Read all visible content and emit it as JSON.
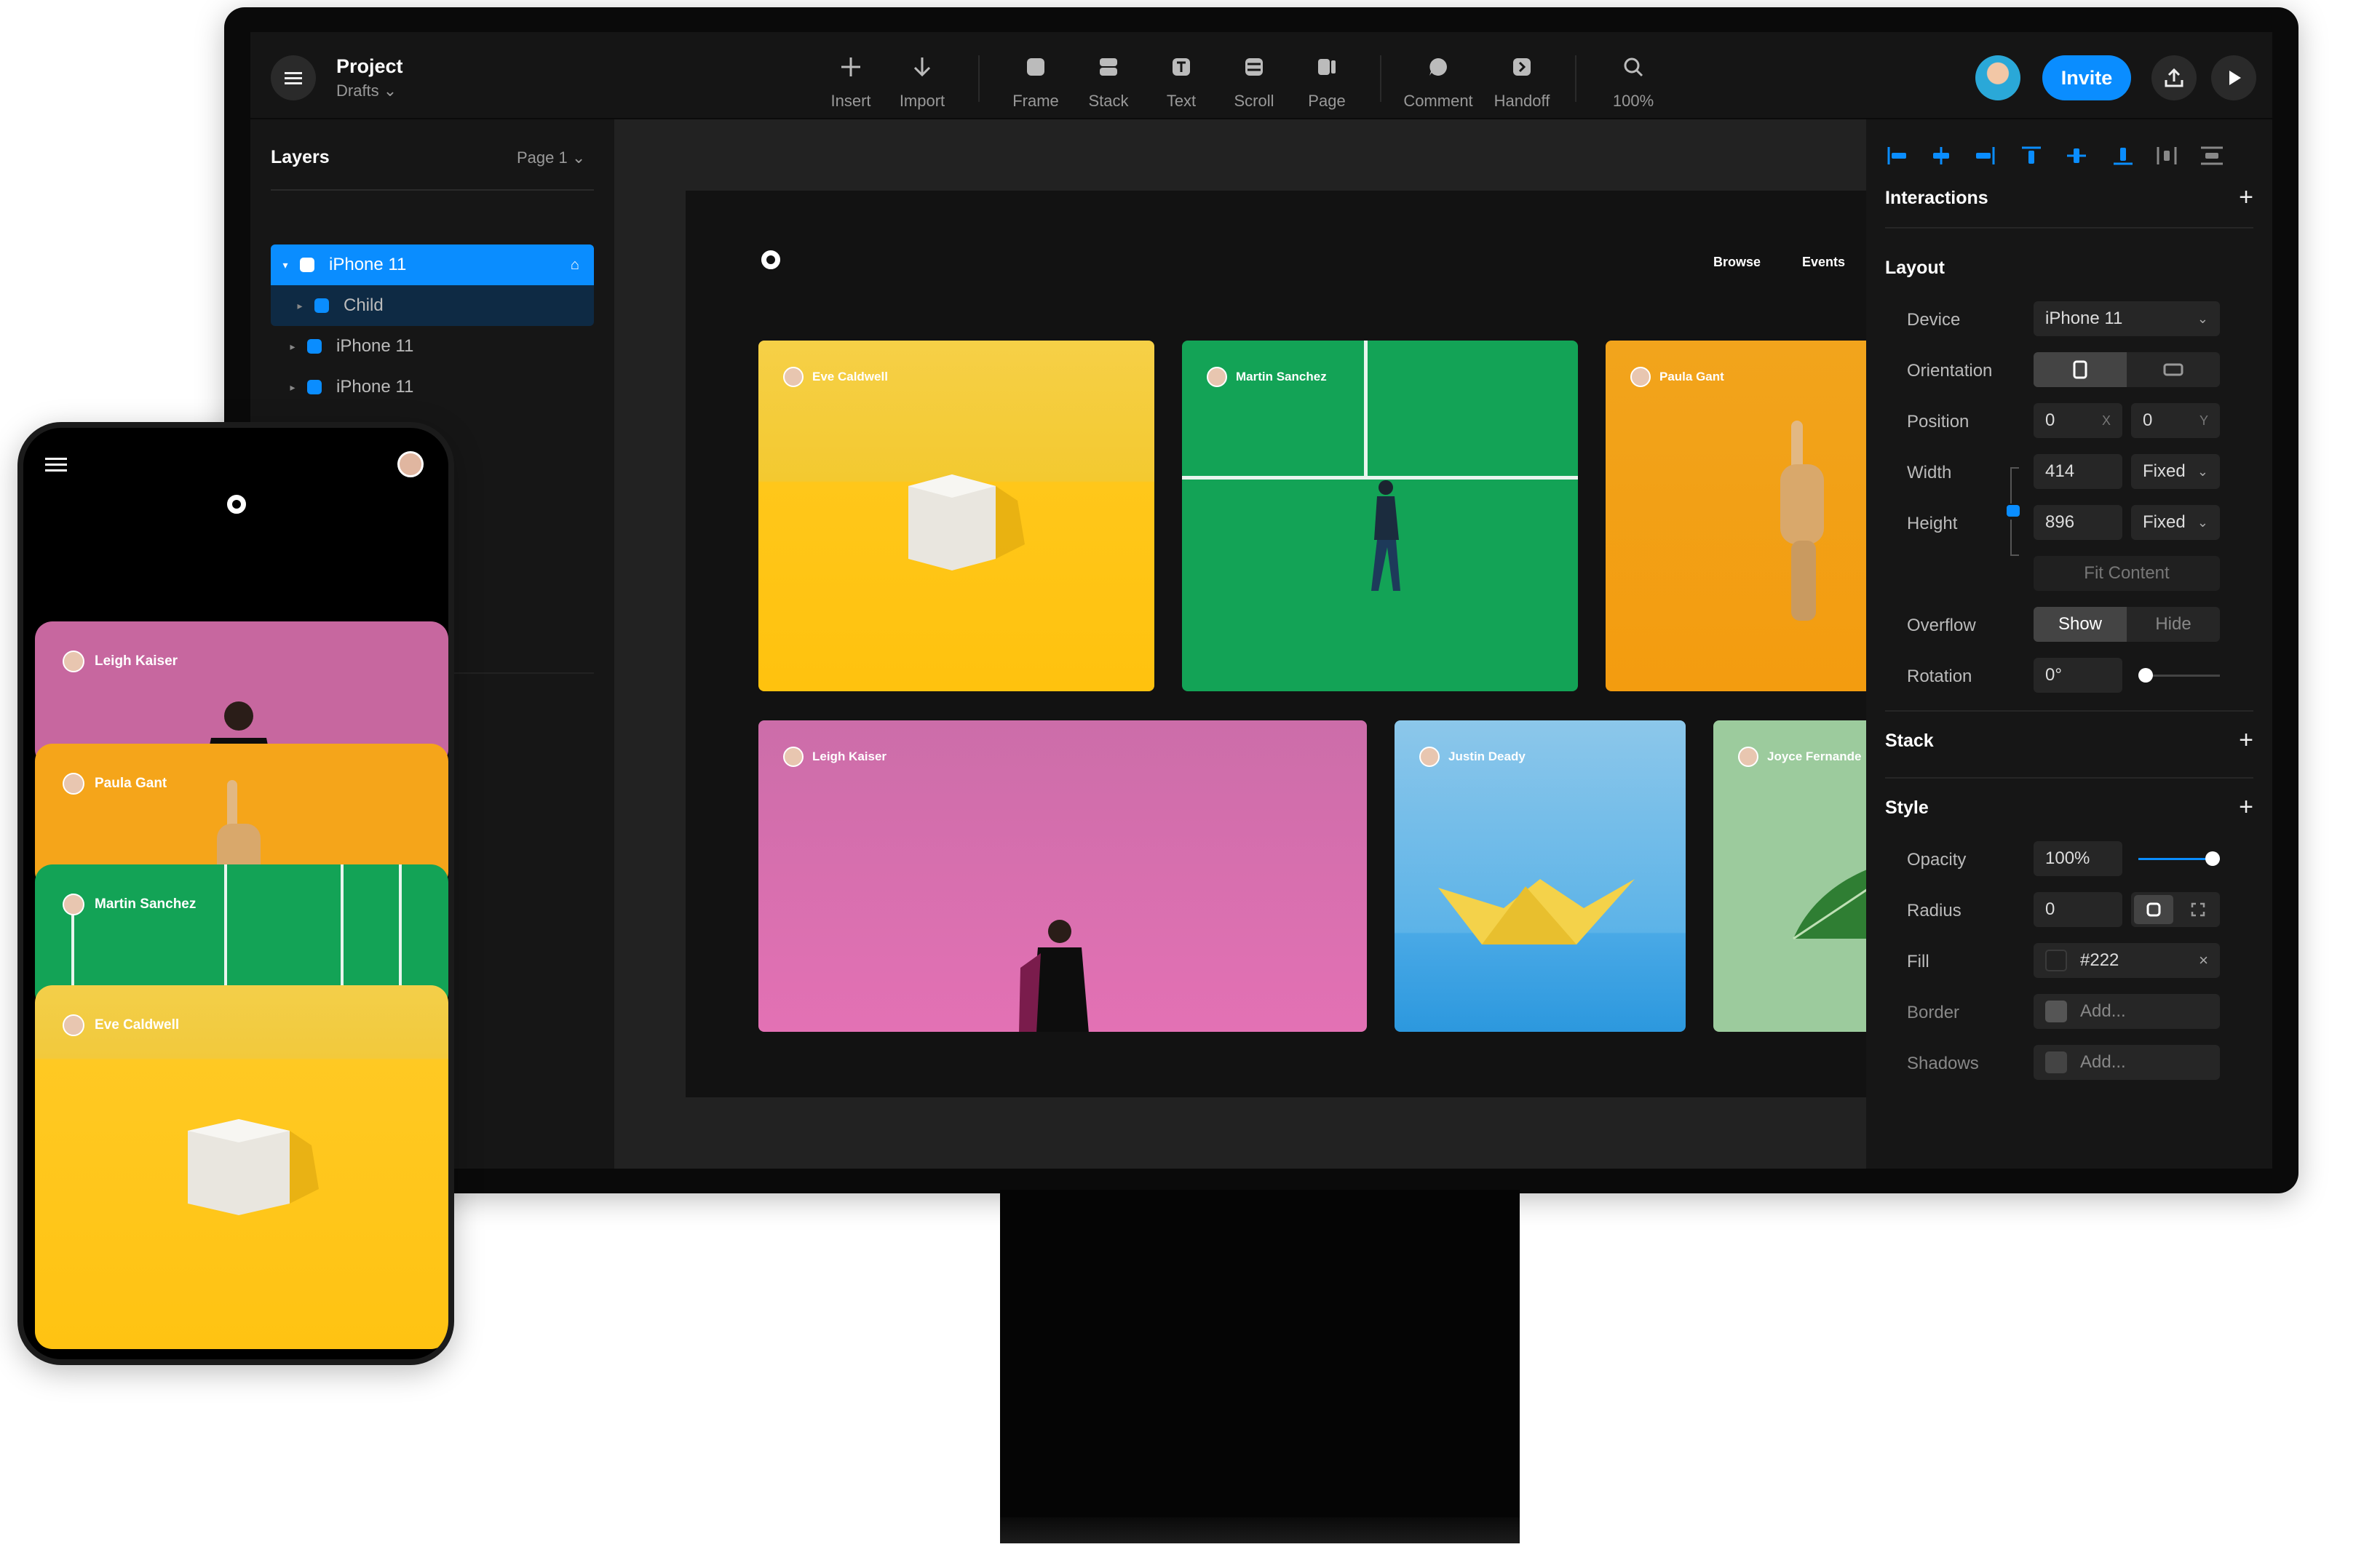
{
  "project": {
    "title": "Project",
    "subtitle": "Drafts ⌄"
  },
  "toolbar": [
    {
      "label": "Insert",
      "icon": "plus-icon"
    },
    {
      "label": "Import",
      "icon": "arrow-down-icon"
    },
    {
      "label": "Frame",
      "icon": "frame-icon"
    },
    {
      "label": "Stack",
      "icon": "stack-icon"
    },
    {
      "label": "Text",
      "icon": "text-icon"
    },
    {
      "label": "Scroll",
      "icon": "scroll-icon"
    },
    {
      "label": "Page",
      "icon": "page-icon"
    },
    {
      "label": "Comment",
      "icon": "comment-icon"
    },
    {
      "label": "Handoff",
      "icon": "handoff-icon"
    },
    {
      "label": "100%",
      "icon": "search-icon"
    }
  ],
  "topright": {
    "invite_label": "Invite"
  },
  "layers": {
    "title": "Layers",
    "page": "Page 1",
    "items": [
      {
        "label": "iPhone 11"
      },
      {
        "label": "Child"
      },
      {
        "label": "iPhone 11"
      },
      {
        "label": "iPhone 11"
      }
    ]
  },
  "site": {
    "nav": [
      "Browse",
      "Events"
    ],
    "cards": [
      {
        "author": "Eve Caldwell"
      },
      {
        "author": "Martin Sanchez"
      },
      {
        "author": "Paula Gant"
      },
      {
        "author": "Leigh Kaiser"
      },
      {
        "author": "Justin Deady"
      },
      {
        "author": "Joyce Fernande"
      }
    ]
  },
  "phone": {
    "cards": [
      {
        "author": "Leigh Kaiser"
      },
      {
        "author": "Paula Gant"
      },
      {
        "author": "Martin Sanchez"
      },
      {
        "author": "Eve Caldwell"
      }
    ]
  },
  "props": {
    "interactions": "Interactions",
    "layout": "Layout",
    "device_label": "Device",
    "device_value": "iPhone 11",
    "orientation_label": "Orientation",
    "position_label": "Position",
    "pos_x": "0",
    "pos_x_sfx": "X",
    "pos_y": "0",
    "pos_y_sfx": "Y",
    "width_label": "Width",
    "width_value": "414",
    "width_mode": "Fixed",
    "height_label": "Height",
    "height_value": "896",
    "height_mode": "Fixed",
    "fit_content": "Fit Content",
    "overflow_label": "Overflow",
    "overflow_show": "Show",
    "overflow_hide": "Hide",
    "rotation_label": "Rotation",
    "rotation_value": "0°",
    "rotation_slider": 0,
    "stack": "Stack",
    "style": "Style",
    "opacity_label": "Opacity",
    "opacity_value": "100%",
    "opacity_slider": 1.0,
    "radius_label": "Radius",
    "radius_value": "0",
    "fill_label": "Fill",
    "fill_value": "#222",
    "border_label": "Border",
    "border_value": "Add...",
    "shadows_label": "Shadows",
    "shadows_value": "Add..."
  },
  "colors": {
    "accent": "#0a8dff",
    "fill": "#222222"
  }
}
